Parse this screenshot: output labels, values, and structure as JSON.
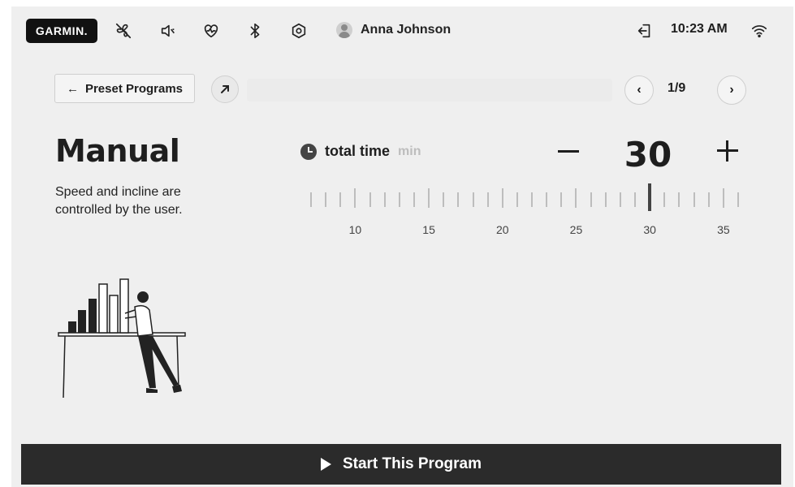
{
  "status_bar": {
    "brand": "GARMIN.",
    "icons": [
      "no-fan-icon",
      "volume-low-icon",
      "heart-rate-icon",
      "bluetooth-icon",
      "settings-hex-icon",
      "logout-icon",
      "wifi-icon"
    ],
    "user_name": "Anna Johnson",
    "time": "10:23 AM"
  },
  "nav": {
    "back_label": "Preset Programs",
    "page_indicator": "1/9",
    "prev_icon": "chevron-left-icon",
    "next_icon": "chevron-right-icon"
  },
  "program": {
    "title": "Manual",
    "description": "Speed and incline are controlled by the user."
  },
  "time_control": {
    "label": "total time",
    "unit": "min",
    "value": "30",
    "min_visible": 7,
    "max_visible": 36,
    "tick_labels": [
      "10",
      "15",
      "20",
      "25",
      "30",
      "35"
    ]
  },
  "footer": {
    "start_label": "Start This Program"
  },
  "colors": {
    "background": "#efefef",
    "accent_dark": "#2b2b2b"
  }
}
